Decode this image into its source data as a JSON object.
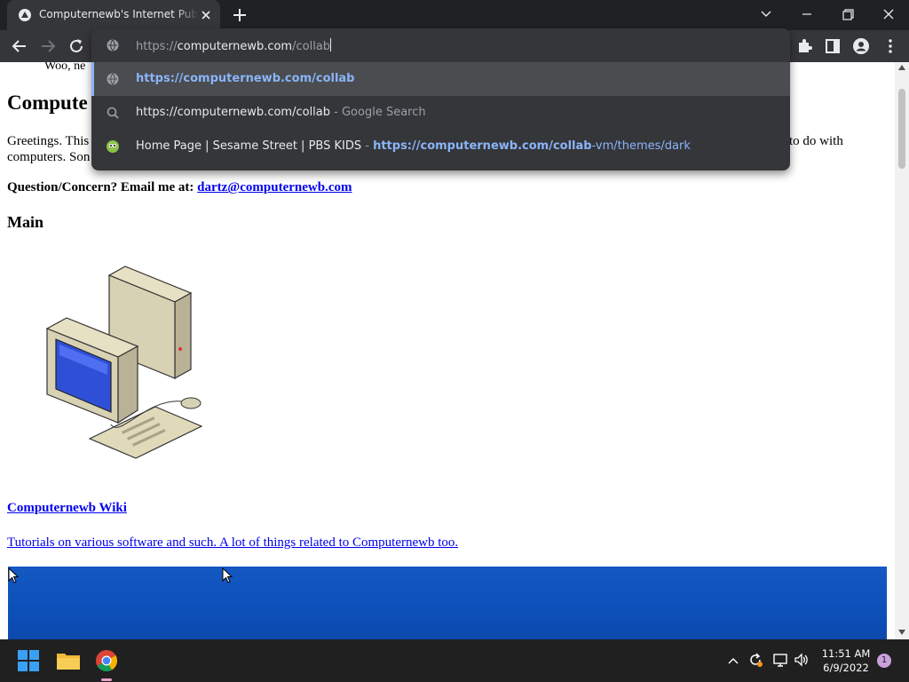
{
  "browser": {
    "tab_title": "Computernewb's Internet Pub Hub",
    "omnibox": {
      "typed_text": "computernewb.com",
      "scheme_prefix": "https://",
      "autocomplete_suffix": "/collab",
      "suggestions": [
        {
          "text": "https://computernewb.com/collab",
          "icon": "globe-icon"
        },
        {
          "text": "https://computernewb.com/collab",
          "suffix": " - Google Search",
          "icon": "search-icon"
        },
        {
          "title": "Home Page | Sesame Street | PBS KIDS",
          "separator": " - ",
          "url_bold": "https://computernewb.com/collab",
          "url_rest": "-vm/themes/dark",
          "icon": "site-favicon"
        }
      ]
    }
  },
  "page": {
    "partial_text_top": "Woo, ne",
    "heading_partial": "Compute",
    "greeting_partial_left": "Greetings. This",
    "greeting_line2_partial": "computers. Son",
    "greeting_right_fragment": "to do with",
    "contact_label": "Question/Concern? Email me at:",
    "contact_email": "dartz@computernewb.com",
    "main_heading": "Main",
    "wiki_link": "Computernewb Wiki",
    "wiki_description": "Tutorials on various software and such. A lot of things related to Computernewb too."
  },
  "taskbar": {
    "time": "11:51 AM",
    "date": "6/9/2022",
    "notification_count": "1"
  },
  "colors": {
    "chrome_dark": "#202124",
    "chrome_toolbar": "#35363a",
    "link_blue": "#0000ee",
    "suggestion_blue": "#8ab4f8",
    "taskbar": "#202020",
    "banner_blue": "#1458c2"
  }
}
